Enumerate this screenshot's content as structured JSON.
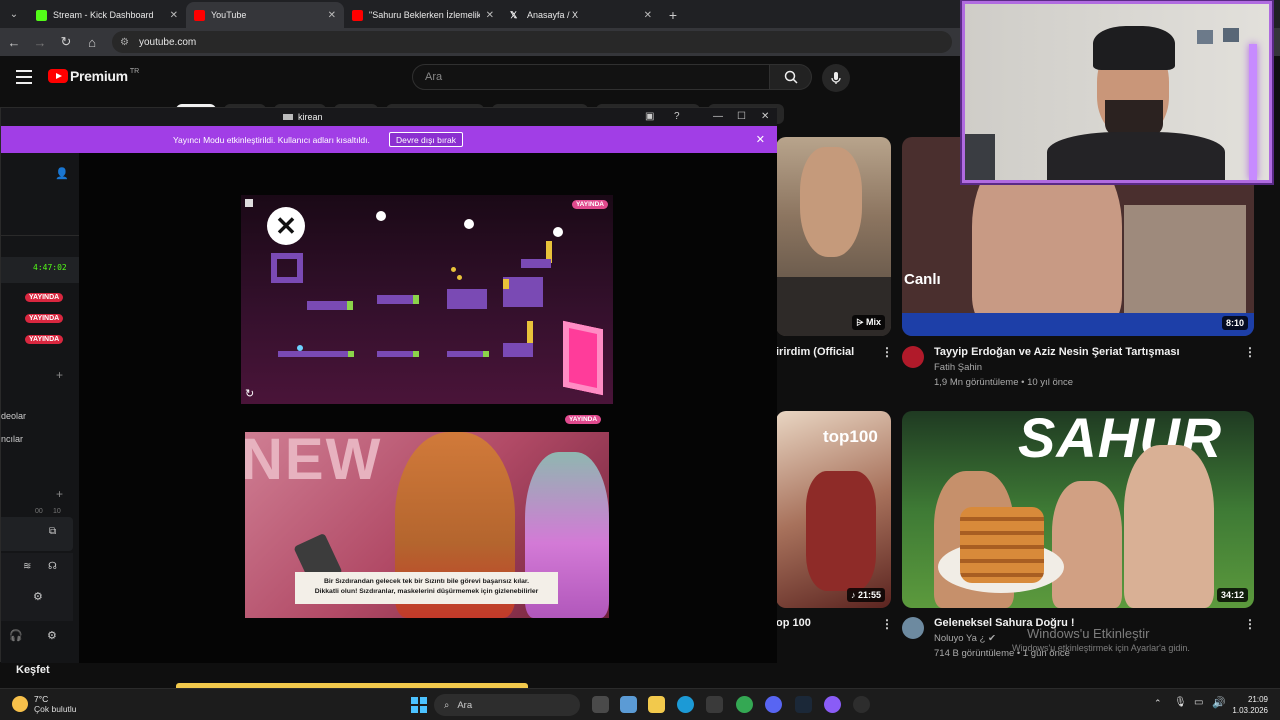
{
  "browser": {
    "tabs": [
      {
        "label": "Stream - Kick Dashboard",
        "color": "#53fc18"
      },
      {
        "label": "YouTube",
        "color": "#ff0000"
      },
      {
        "label": "\"Sahuru Beklerken İzlemelik Ed",
        "color": "#ff0000"
      },
      {
        "label": "Anasayfa / X",
        "color": "#ffffff"
      }
    ],
    "url": "youtube.com"
  },
  "youtube": {
    "brand": "Premium",
    "region": "TR",
    "search_placeholder": "Ara",
    "videos": [
      {
        "title": "irirdim (Official",
        "channel": "",
        "meta": "",
        "duration": "Mix"
      },
      {
        "title": "Tayyip Erdoğan ve Aziz Nesin Şeriat Tartışması",
        "channel": "Fatih Şahin",
        "meta": "1,9 Mn görüntüleme • 10 yıl önce",
        "duration": "8:10",
        "overlay": "Canlı"
      },
      {
        "title": "op 100",
        "channel": "",
        "meta": "",
        "duration": "21:55",
        "overlay": "top100"
      },
      {
        "title": "Geleneksel Sahura Doğru !",
        "channel": "Noluyo Ya ¿",
        "meta": "714 B görüntüleme • 1 gün önce",
        "duration": "34:12",
        "overlay": "SAHUR"
      }
    ],
    "explore_label": "Keşfet",
    "watermark_title": "Windows'u Etkinleştir",
    "watermark_sub": "Windows'u etkinleştirmek için Ayarlar'a gidin."
  },
  "kick_popup": {
    "window_title": "kirean",
    "banner_text": "Yayıncı Modu etkinleştirildi. Kullanıcı adları kısaltıldı.",
    "banner_button": "Devre dışı bırak",
    "sidebar": {
      "timer": "4:47:02",
      "live_badges": [
        "YAYINDA",
        "YAYINDA",
        "YAYINDA"
      ],
      "labels": [
        "deolar",
        "ncılar"
      ],
      "counters": [
        "00",
        "10"
      ]
    },
    "live_label": "YAYINDA",
    "subtitle_line1": "Bir Sızdırandan gelecek tek bir Sızıntı bile görevi başarısız kılar.",
    "subtitle_line2": "Dikkatli olun! Sızdıranlar, maskelerini düşürmemek için gizlenebilirler"
  },
  "taskbar": {
    "weather_temp": "7°C",
    "weather_desc": "Çok bulutlu",
    "search_label": "Ara",
    "time": "21:09",
    "date": "1.03.2026"
  }
}
